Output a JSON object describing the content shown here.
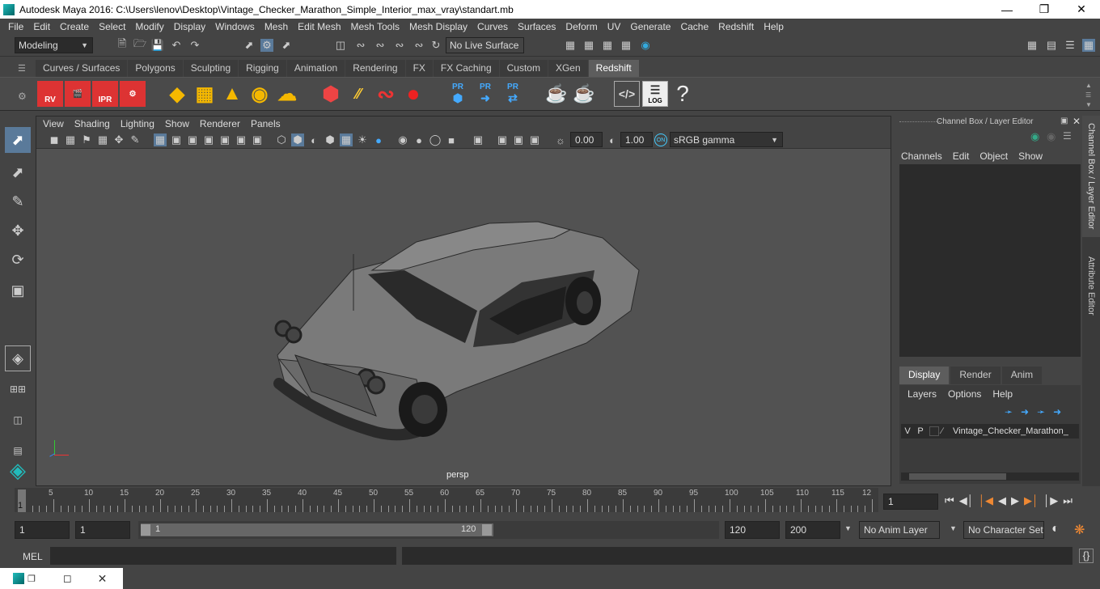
{
  "window": {
    "title": "Autodesk Maya 2016: C:\\Users\\lenov\\Desktop\\Vintage_Checker_Marathon_Simple_Interior_max_vray\\standart.mb"
  },
  "menubar": [
    "File",
    "Edit",
    "Create",
    "Select",
    "Modify",
    "Display",
    "Windows",
    "Mesh",
    "Edit Mesh",
    "Mesh Tools",
    "Mesh Display",
    "Curves",
    "Surfaces",
    "Deform",
    "UV",
    "Generate",
    "Cache",
    "Redshift",
    "Help"
  ],
  "status": {
    "menu_set": "Modeling",
    "live_surface": "No Live Surface"
  },
  "shelf": {
    "tabs": [
      "Curves / Surfaces",
      "Polygons",
      "Sculpting",
      "Rigging",
      "Animation",
      "Rendering",
      "FX",
      "FX Caching",
      "Custom",
      "XGen",
      "Redshift"
    ],
    "active": "Redshift",
    "icon_labels": {
      "rv": "RV",
      "ipr": "IPR",
      "pr": "PR",
      "log": "LOG",
      "help": "?"
    }
  },
  "viewport": {
    "menu": [
      "View",
      "Shading",
      "Lighting",
      "Show",
      "Renderer",
      "Panels"
    ],
    "exposure": "0.00",
    "gamma": "1.00",
    "color_space": "sRGB gamma",
    "camera": "persp"
  },
  "channelbox": {
    "title": "Channel Box / Layer Editor",
    "menu": [
      "Channels",
      "Edit",
      "Object",
      "Show"
    ],
    "layer_tabs": [
      "Display",
      "Render",
      "Anim"
    ],
    "active_layer_tab": "Display",
    "layer_menu": [
      "Layers",
      "Options",
      "Help"
    ],
    "layer": {
      "v": "V",
      "p": "P",
      "name": "Vintage_Checker_Marathon_"
    }
  },
  "side_tabs": [
    "Channel Box / Layer Editor",
    "Attribute Editor"
  ],
  "timeline": {
    "ticks": [
      "5",
      "10",
      "15",
      "20",
      "25",
      "30",
      "35",
      "40",
      "45",
      "50",
      "55",
      "60",
      "65",
      "70",
      "75",
      "80",
      "85",
      "90",
      "95",
      "100",
      "105",
      "110",
      "115",
      "12"
    ],
    "start_label": "1",
    "current_frame": "1"
  },
  "range": {
    "start": "1",
    "playback_start": "1",
    "slider_start": "1",
    "slider_end": "120",
    "playback_end": "120",
    "end": "200",
    "anim_layer": "No Anim Layer",
    "char_set": "No Character Set"
  },
  "mel": {
    "label": "MEL"
  }
}
